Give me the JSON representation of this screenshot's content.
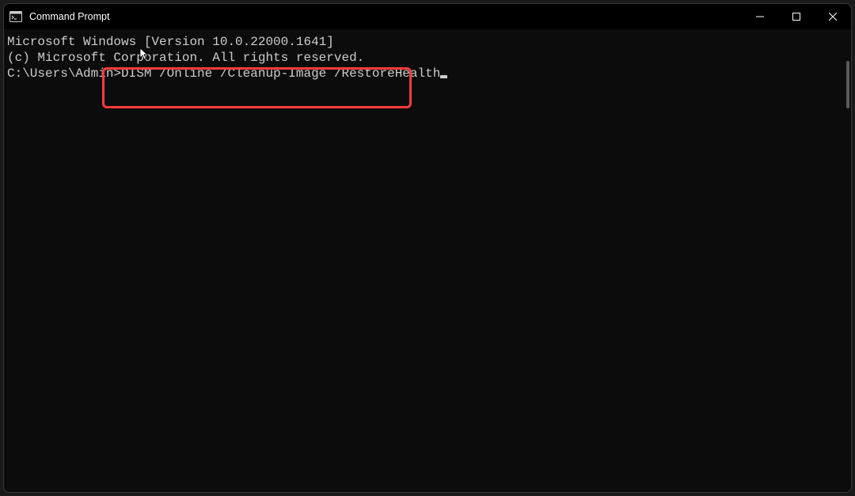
{
  "titlebar": {
    "title": "Command Prompt",
    "icon_name": "cmd-icon"
  },
  "window_controls": {
    "minimize": "minimize",
    "maximize": "maximize",
    "close": "close"
  },
  "terminal": {
    "line1": "Microsoft Windows [Version 10.0.22000.1641]",
    "line2": "(c) Microsoft Corporation. All rights reserved.",
    "blank": "",
    "prompt": "C:\\Users\\Admin>",
    "command": "DISM /Online /Cleanup-Image /RestoreHealth"
  }
}
